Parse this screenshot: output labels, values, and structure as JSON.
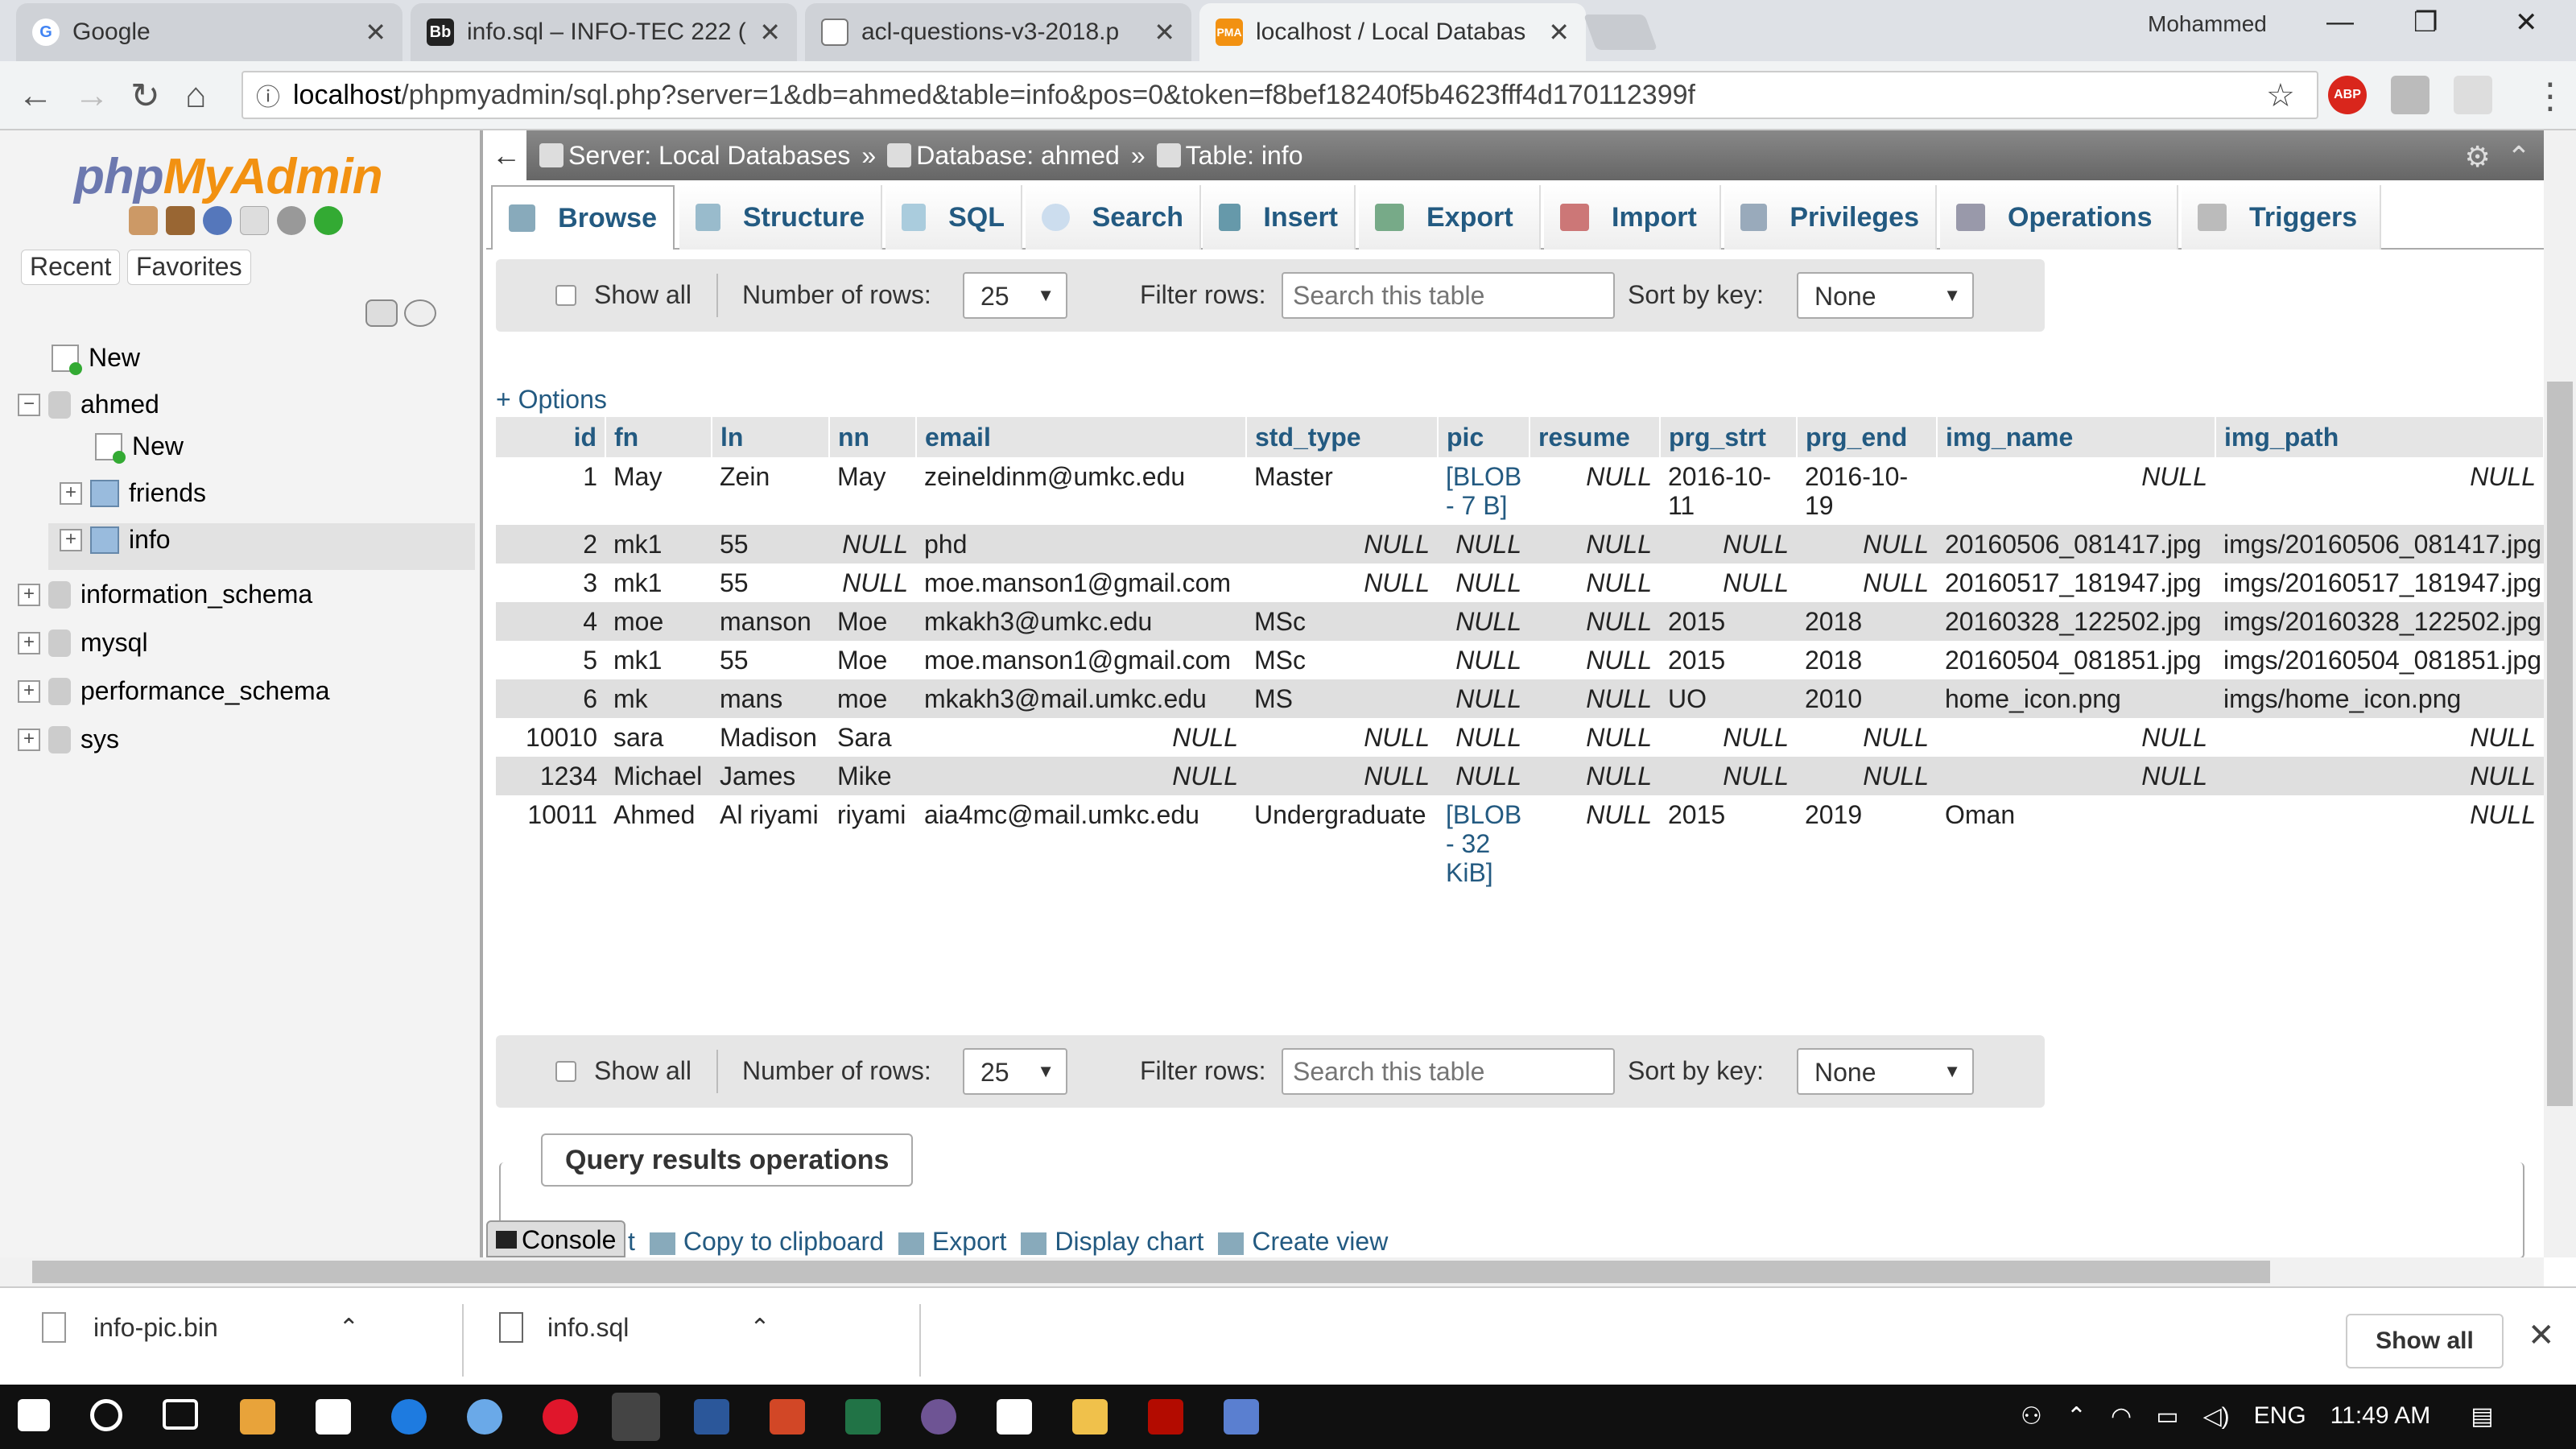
{
  "browser": {
    "tabs": [
      {
        "title": "Google",
        "icon": "google-icon"
      },
      {
        "title": "info.sql – INFO-TEC 222 (",
        "icon": "blackboard-icon"
      },
      {
        "title": "acl-questions-v3-2018.p",
        "icon": "document-icon"
      },
      {
        "title": "localhost / Local Databas",
        "icon": "phpmyadmin-icon",
        "active": true
      }
    ],
    "profile_name": "Mohammed",
    "url_host": "localhost",
    "url_rest": "/phpmyadmin/sql.php?server=1&db=ahmed&table=info&pos=0&token=f8bef18240f5b4623fff4d170112399f",
    "ext_abp": "ABP"
  },
  "sidebar": {
    "logo_php": "php",
    "logo_myadmin": "MyAdmin",
    "recent": "Recent",
    "favorites": "Favorites",
    "tree": [
      {
        "label": "New"
      },
      {
        "label": "ahmed"
      },
      {
        "label": "New"
      },
      {
        "label": "friends"
      },
      {
        "label": "info"
      },
      {
        "label": "information_schema"
      },
      {
        "label": "mysql"
      },
      {
        "label": "performance_schema"
      },
      {
        "label": "sys"
      }
    ]
  },
  "breadcrumb": {
    "server": "Server: Local Databases",
    "database": "Database: ahmed",
    "table": "Table: info",
    "sep": "»"
  },
  "tabs": [
    "Browse",
    "Structure",
    "SQL",
    "Search",
    "Insert",
    "Export",
    "Import",
    "Privileges",
    "Operations",
    "Triggers"
  ],
  "nav": {
    "show_all": "Show all",
    "num_rows_label": "Number of rows:",
    "num_rows_value": "25",
    "filter_label": "Filter rows:",
    "filter_placeholder": "Search this table",
    "sort_label": "Sort by key:",
    "sort_value": "None"
  },
  "options_link": "+ Options",
  "table": {
    "columns": [
      "id",
      "fn",
      "ln",
      "nn",
      "email",
      "std_type",
      "pic",
      "resume",
      "prg_strt",
      "prg_end",
      "img_name",
      "img_path"
    ],
    "rows": [
      [
        "1",
        "May",
        "Zein",
        "May",
        "zeineldinm@umkc.edu",
        "Master",
        "[BLOB - 7 B]",
        "NULL",
        "2016-10-11",
        "2016-10-19",
        "NULL",
        "NULL"
      ],
      [
        "2",
        "mk1",
        "55",
        "NULL",
        "phd",
        "NULL",
        "NULL",
        "NULL",
        "NULL",
        "NULL",
        "20160506_081417.jpg",
        "imgs/20160506_081417.jpg"
      ],
      [
        "3",
        "mk1",
        "55",
        "NULL",
        "moe.manson1@gmail.com",
        "NULL",
        "NULL",
        "NULL",
        "NULL",
        "NULL",
        "20160517_181947.jpg",
        "imgs/20160517_181947.jpg"
      ],
      [
        "4",
        "moe",
        "manson",
        "Moe",
        "mkakh3@umkc.edu",
        "MSc",
        "NULL",
        "NULL",
        "2015",
        "2018",
        "20160328_122502.jpg",
        "imgs/20160328_122502.jpg"
      ],
      [
        "5",
        "mk1",
        "55",
        "Moe",
        "moe.manson1@gmail.com",
        "MSc",
        "NULL",
        "NULL",
        "2015",
        "2018",
        "20160504_081851.jpg",
        "imgs/20160504_081851.jpg"
      ],
      [
        "6",
        "mk",
        "mans",
        "moe",
        "mkakh3@mail.umkc.edu",
        "MS",
        "NULL",
        "NULL",
        "UO",
        "2010",
        "home_icon.png",
        "imgs/home_icon.png"
      ],
      [
        "10010",
        "sara",
        "Madison",
        "Sara",
        "NULL",
        "NULL",
        "NULL",
        "NULL",
        "NULL",
        "NULL",
        "NULL",
        "NULL"
      ],
      [
        "1234",
        "Michael",
        "James",
        "Mike",
        "NULL",
        "NULL",
        "NULL",
        "NULL",
        "NULL",
        "NULL",
        "NULL",
        "NULL"
      ],
      [
        "10011",
        "Ahmed",
        "Al riyami",
        "riyami",
        "aia4mc@mail.umkc.edu",
        "Undergraduate",
        "[BLOB - 32 KiB]",
        "NULL",
        "2015",
        "2019",
        "Oman",
        "NULL"
      ]
    ]
  },
  "query_results": {
    "title": "Query results operations",
    "console": "Console",
    "links": [
      "t",
      "Copy to clipboard",
      "Export",
      "Display chart",
      "Create view"
    ]
  },
  "downloads": {
    "items": [
      "info-pic.bin",
      "info.sql"
    ],
    "show_all": "Show all"
  },
  "taskbar": {
    "lang": "ENG",
    "time": "11:49 AM"
  }
}
